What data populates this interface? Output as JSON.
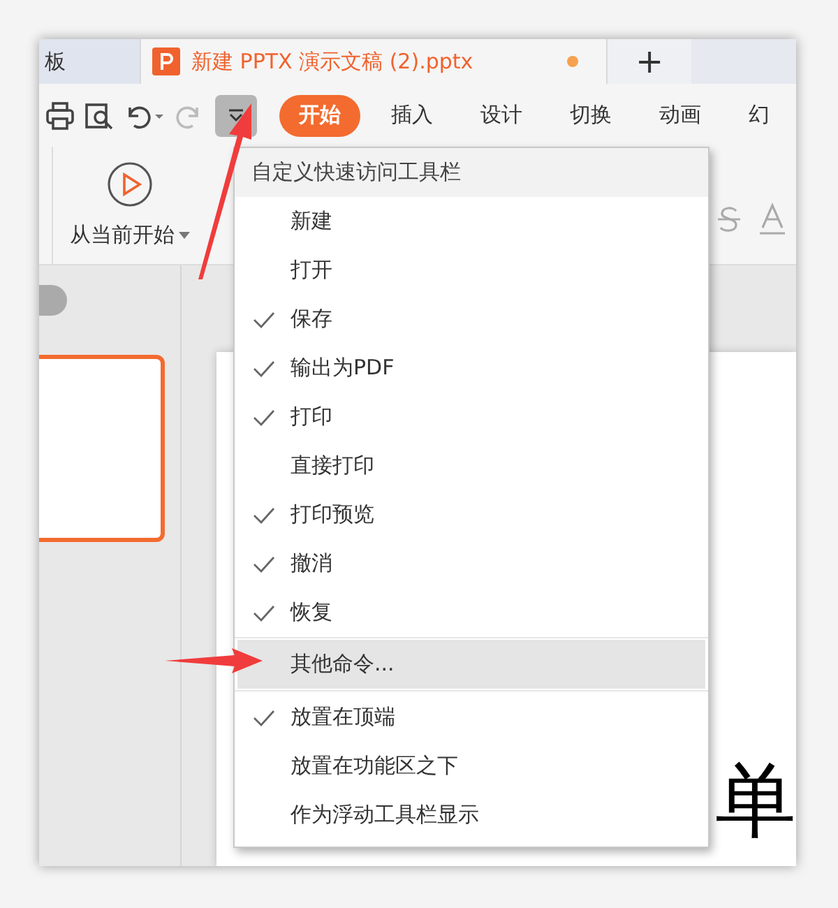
{
  "tabs": [
    {
      "title": "板",
      "selected": false,
      "unsaved": false
    },
    {
      "title": "新建 PPTX 演示文稿 (2).pptx",
      "selected": true,
      "unsaved": true
    }
  ],
  "new_tab_button": "+",
  "ribbon_tabs": [
    {
      "label": "开始",
      "selected": true
    },
    {
      "label": "插入",
      "selected": false
    },
    {
      "label": "设计",
      "selected": false
    },
    {
      "label": "切换",
      "selected": false
    },
    {
      "label": "动画",
      "selected": false
    },
    {
      "label": "幻",
      "selected": false
    }
  ],
  "ribbon": {
    "play_button": "从当前开始"
  },
  "slide": {
    "text": "单"
  },
  "menu": {
    "title": "自定义快速访问工具栏",
    "sections": [
      [
        {
          "label": "新建",
          "checked": false,
          "selected": false
        },
        {
          "label": "打开",
          "checked": false,
          "selected": false
        },
        {
          "label": "保存",
          "checked": true,
          "selected": false
        },
        {
          "label": "输出为PDF",
          "checked": true,
          "selected": false
        },
        {
          "label": "打印",
          "checked": true,
          "selected": false
        },
        {
          "label": "直接打印",
          "checked": false,
          "selected": false
        },
        {
          "label": "打印预览",
          "checked": true,
          "selected": false
        },
        {
          "label": "撤消",
          "checked": true,
          "selected": false
        },
        {
          "label": "恢复",
          "checked": true,
          "selected": false
        }
      ],
      [
        {
          "label": "其他命令...",
          "checked": false,
          "selected": true
        }
      ],
      [
        {
          "label": "放置在顶端",
          "checked": true,
          "selected": false
        },
        {
          "label": "放置在功能区之下",
          "checked": false,
          "selected": false
        },
        {
          "label": "作为浮动工具栏显示",
          "checked": false,
          "selected": false
        }
      ]
    ]
  }
}
